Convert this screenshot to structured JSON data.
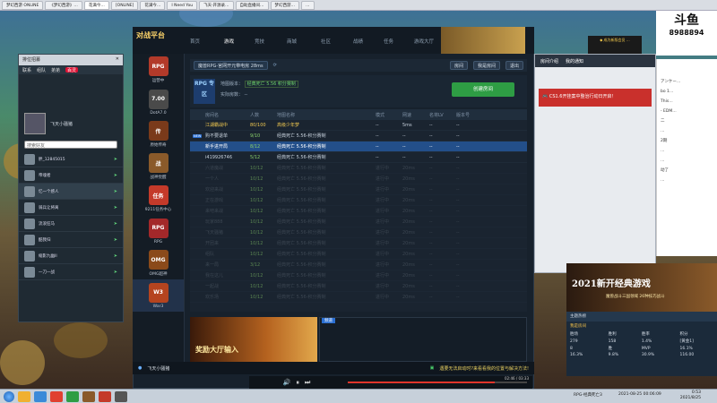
{
  "browser_tabs": [
    "梦幻西游 ONLINE",
    "《梦幻西游》…",
    "花满今…",
    "[ONLINE]",
    "花满今…",
    "I Need You",
    "飞天·开源录…",
    "自助直播间…",
    "梦幻西游…",
    "…"
  ],
  "friend_panel": {
    "title": "排位招募",
    "header_tabs": [
      "联系",
      "组队",
      "弟弟"
    ],
    "header_badge": "百灵",
    "my_name": "飞天小骚猪",
    "search_placeholder": "搜索好友",
    "list": [
      {
        "name": "胖_12845015",
        "selected": false
      },
      {
        "name": "帝魂者",
        "selected": false
      },
      {
        "name": "忆一个感人",
        "selected": true
      },
      {
        "name": "骑兵让将离",
        "selected": false
      },
      {
        "name": "流浪狂马",
        "selected": false
      },
      {
        "name": "酷我归",
        "selected": false
      },
      {
        "name": "缩影九幽II",
        "selected": false
      },
      {
        "name": "一刀一战",
        "selected": false
      }
    ]
  },
  "app": {
    "logo": "对战平台",
    "nav": [
      "首页",
      "游戏",
      "竞技",
      "商城",
      "社区",
      "战绩",
      "任务",
      "游戏大厅"
    ],
    "nav_active": 1,
    "room_selector": "魔兽RPG-官网开元带电房 28ms",
    "room_buttons": [
      "房间",
      "我是房间"
    ],
    "exit_label": "退出",
    "rpg_badge": "RPG 专区",
    "map_version_label": "地图版本：",
    "map_version_value": "经典死亡 5.56 积分赛制",
    "room_count_label": "实际房数：",
    "room_count_value": "--",
    "create_button": "创建房间",
    "columns": [
      "房间名",
      "人数",
      "地图名称",
      "模式",
      "网速",
      "名将LV",
      "版本号"
    ],
    "rows": [
      {
        "tag": "",
        "name": "江湖霸战中",
        "count": "80/100",
        "map": "高级少年梦",
        "mode": "--",
        "ping": "5ms",
        "lv": "--",
        "ver": "--",
        "state": "first"
      },
      {
        "tag": "NEW",
        "name": "购不要退单",
        "count": "9/10",
        "map": "经典死亡 5.56-积分赛制",
        "mode": "--",
        "ping": "--",
        "lv": "--",
        "ver": "--",
        "state": "normal"
      },
      {
        "tag": "",
        "name": "新手进开局",
        "count": "8/12",
        "map": "经典死亡 5.56-积分赛制",
        "mode": "--",
        "ping": "--",
        "lv": "--",
        "ver": "--",
        "state": "sel"
      },
      {
        "tag": "",
        "name": "i419926746",
        "count": "5/12",
        "map": "经典死亡 5.56-积分赛制",
        "mode": "--",
        "ping": "--",
        "lv": "--",
        "ver": "--",
        "state": "normal"
      },
      {
        "tag": "",
        "name": "六道魔战",
        "count": "10/12",
        "map": "经典死亡 5.56-积分赛制",
        "mode": "进行中",
        "ping": "20ms",
        "lv": "--",
        "ver": "--",
        "state": "dim"
      },
      {
        "tag": "",
        "name": "一个人",
        "count": "10/12",
        "map": "经典死亡 5.56-积分赛制",
        "mode": "进行中",
        "ping": "20ms",
        "lv": "--",
        "ver": "--",
        "state": "dim"
      },
      {
        "tag": "",
        "name": "欢迎来战",
        "count": "10/12",
        "map": "经典死亡 5.56-积分赛制",
        "mode": "进行中",
        "ping": "20ms",
        "lv": "--",
        "ver": "--",
        "state": "dim"
      },
      {
        "tag": "",
        "name": "正在游戏",
        "count": "10/12",
        "map": "经典死亡 5.56-积分赛制",
        "mode": "进行中",
        "ping": "20ms",
        "lv": "--",
        "ver": "--",
        "state": "dim"
      },
      {
        "tag": "",
        "name": "来吧来战",
        "count": "10/12",
        "map": "经典死亡 5.56-积分赛制",
        "mode": "进行中",
        "ping": "20ms",
        "lv": "--",
        "ver": "--",
        "state": "dim"
      },
      {
        "tag": "",
        "name": "玩家888",
        "count": "10/12",
        "map": "经典死亡 5.56-积分赛制",
        "mode": "进行中",
        "ping": "20ms",
        "lv": "--",
        "ver": "--",
        "state": "dim"
      },
      {
        "tag": "",
        "name": "飞天骚猪",
        "count": "10/12",
        "map": "经典死亡 5.56-积分赛制",
        "mode": "进行中",
        "ping": "20ms",
        "lv": "--",
        "ver": "--",
        "state": "dim"
      },
      {
        "tag": "",
        "name": "开团来",
        "count": "10/12",
        "map": "经典死亡 5.56-积分赛制",
        "mode": "进行中",
        "ping": "20ms",
        "lv": "--",
        "ver": "--",
        "state": "dim"
      },
      {
        "tag": "",
        "name": "组队",
        "count": "10/12",
        "map": "经典死亡 5.56-积分赛制",
        "mode": "进行中",
        "ping": "20ms",
        "lv": "--",
        "ver": "--",
        "state": "dim"
      },
      {
        "tag": "",
        "name": "来一局",
        "count": "3/12",
        "map": "经典死亡 5.56-积分赛制",
        "mode": "进行中",
        "ping": "20ms",
        "lv": "--",
        "ver": "--",
        "state": "dim"
      },
      {
        "tag": "",
        "name": "我在这儿",
        "count": "10/12",
        "map": "经典死亡 5.56-积分赛制",
        "mode": "进行中",
        "ping": "20ms",
        "lv": "--",
        "ver": "--",
        "state": "dim"
      },
      {
        "tag": "",
        "name": "一起战",
        "count": "10/12",
        "map": "经典死亡 5.56-积分赛制",
        "mode": "进行中",
        "ping": "20ms",
        "lv": "--",
        "ver": "--",
        "state": "dim"
      },
      {
        "tag": "",
        "name": "欢乐场",
        "count": "10/12",
        "map": "经典死亡 5.56-积分赛制",
        "mode": "进行中",
        "ping": "20ms",
        "lv": "--",
        "ver": "--",
        "state": "dim"
      }
    ],
    "games": [
      {
        "label": "运营中",
        "short": "RPG",
        "color": "#b23a2a"
      },
      {
        "label": "DotA7.0",
        "short": "7.00",
        "color": "#4a4a4a"
      },
      {
        "label": "原始传奇",
        "short": "传",
        "color": "#7a3a1a"
      },
      {
        "label": "战神觉醒",
        "short": "战",
        "color": "#8a5a2a"
      },
      {
        "label": "9211任务中心",
        "short": "任务",
        "color": "#c43a2a"
      },
      {
        "label": "RPG",
        "short": "RPG",
        "color": "#a3282a"
      },
      {
        "label": "OMG超神",
        "short": "OMG",
        "color": "#8a4a1a"
      },
      {
        "label": "War3",
        "short": "W3",
        "color": "#b5441f"
      }
    ],
    "ad_text": "奖励大厅输入",
    "chat_tab": "频道",
    "bottom_user": "飞天小骚猪",
    "bottom_notice": "遇要无法启动时?来看看我的位置与解决方法!"
  },
  "right_panel": {
    "tabs": [
      "房间介绍",
      "我的通知"
    ],
    "notice": "CS1.6开挂案中整治行动日开启！",
    "brand_text": "斗鱼",
    "brand_num": "8988894",
    "side_items": [
      "アンケー…",
      "bo 1…",
      "This…",
      "- EDM…",
      "二",
      "…",
      "2期",
      "…",
      "…",
      "动了",
      "…"
    ]
  },
  "promo": {
    "title": "2021新开经典游戏",
    "sub": "魔兽战斗三国领域 26种技巧战斗"
  },
  "stats": {
    "header": "主题热榜",
    "label": "我是房间",
    "rows": [
      [
        "胜场",
        "胜利",
        "胜率",
        "积分"
      ],
      [
        "279",
        "158",
        "1.4%",
        "[黄金1]"
      ],
      [
        "8",
        "胜",
        "MVP",
        "16.1%"
      ],
      [
        "16.3%",
        "9.8%",
        "30.9%",
        "116.00"
      ]
    ]
  },
  "player": {
    "time_elapsed": "02:46",
    "time_total": "03:33",
    "progress": 0.82
  },
  "taskbar": {
    "video_title": "RPG-经典死亡3",
    "date_text": "2021-08-25 00:06:09",
    "clock_time": "0:53",
    "clock_date": "2021/8/25"
  },
  "colors": {
    "accent_blue": "#234f8a",
    "create_green": "#2e9d44",
    "notice_red": "#c9302c",
    "gold": "#f0c850"
  }
}
